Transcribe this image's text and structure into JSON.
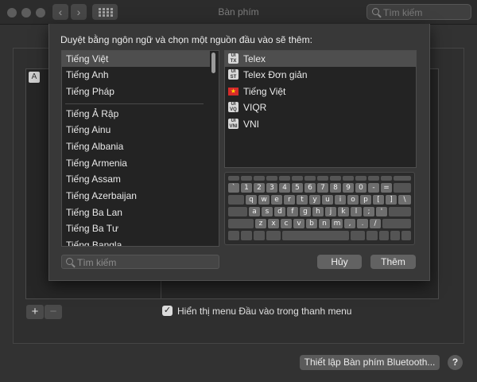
{
  "window": {
    "title": "Bàn phím"
  },
  "toolbar": {
    "search_placeholder": "Tìm kiếm",
    "back": "‹",
    "forward": "›"
  },
  "background": {
    "input_item_icon": "A",
    "add_label": "+",
    "remove_label": "−",
    "show_menu_checked": true,
    "show_menu_label": "Hiển thị menu Đầu vào trong thanh menu",
    "bluetooth_button": "Thiết lập Bàn phím Bluetooth...",
    "help_label": "?"
  },
  "sheet": {
    "prompt": "Duyệt bằng ngôn ngữ và chọn một nguồn đầu vào sẽ thêm:",
    "languages": [
      "Tiếng Việt",
      "Tiếng Anh",
      "Tiếng Pháp",
      "Tiếng Ả Rập",
      "Tiếng Ainu",
      "Tiếng Albania",
      "Tiếng Armenia",
      "Tiếng Assam",
      "Tiếng Azerbaijan",
      "Tiếng Ba Lan",
      "Tiếng Ba Tư",
      "Tiếng Bangla"
    ],
    "selected_language": "Tiếng Việt",
    "input_sources": [
      {
        "label": "Telex",
        "icon": "im-icon",
        "badge": [
          "UI",
          "TX"
        ]
      },
      {
        "label": "Telex Đơn giản",
        "icon": "im-icon",
        "badge": [
          "UI",
          "ST"
        ]
      },
      {
        "label": "Tiếng Việt",
        "icon": "vietnam-flag-icon",
        "badge": [
          "★"
        ]
      },
      {
        "label": "VIQR",
        "icon": "im-icon",
        "badge": [
          "UI",
          "VQ"
        ]
      },
      {
        "label": "VNI",
        "icon": "im-icon",
        "badge": [
          "UI",
          "VNI"
        ]
      }
    ],
    "selected_source": "Telex",
    "search_placeholder": "Tìm kiếm",
    "cancel": "Hủy",
    "add": "Thêm"
  },
  "keyboard": {
    "row1": [
      "`",
      "1",
      "2",
      "3",
      "4",
      "5",
      "6",
      "7",
      "8",
      "9",
      "0",
      "-",
      "="
    ],
    "row2": [
      "q",
      "w",
      "e",
      "r",
      "t",
      "y",
      "u",
      "i",
      "o",
      "p",
      "[",
      "]",
      "\\"
    ],
    "row3": [
      "a",
      "s",
      "d",
      "f",
      "g",
      "h",
      "j",
      "k",
      "l",
      ";",
      "'"
    ],
    "row4": [
      "z",
      "x",
      "c",
      "v",
      "b",
      "n",
      "m",
      ",",
      ".",
      "/"
    ]
  },
  "colors": {
    "window_bg": "#323232",
    "sheet_bg": "#383838",
    "selection": "#4e4e4e"
  }
}
